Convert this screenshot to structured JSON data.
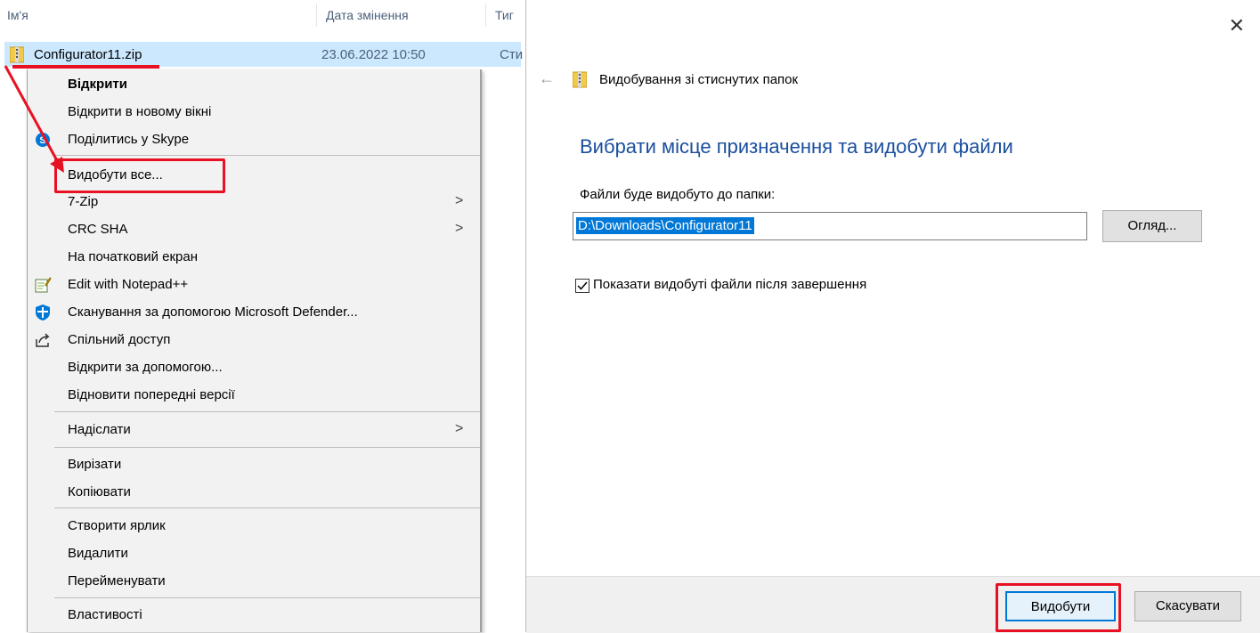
{
  "explorer": {
    "columns": {
      "name": "Ім'я",
      "date": "Дата змінення",
      "type": "Тиг"
    },
    "file": {
      "name": "Configurator11.zip",
      "date": "23.06.2022 10:50",
      "type": "Сти"
    }
  },
  "context_menu": {
    "items": [
      {
        "label": "Відкрити"
      },
      {
        "label": "Відкрити в новому вікні"
      },
      {
        "label": "Поділитись у Skype"
      },
      {
        "label": "Видобути все..."
      },
      {
        "label": "7-Zip"
      },
      {
        "label": "CRC SHA"
      },
      {
        "label": "На початковий екран"
      },
      {
        "label": "Edit with Notepad++"
      },
      {
        "label": "Сканування за допомогою Microsoft Defender..."
      },
      {
        "label": "Спільний доступ"
      },
      {
        "label": "Відкрити за допомогою..."
      },
      {
        "label": "Відновити попередні версії"
      },
      {
        "label": "Надіслати"
      },
      {
        "label": "Вирізати"
      },
      {
        "label": "Копіювати"
      },
      {
        "label": "Створити ярлик"
      },
      {
        "label": "Видалити"
      },
      {
        "label": "Перейменувати"
      },
      {
        "label": "Властивості"
      }
    ]
  },
  "dialog": {
    "title": "Видобування зі стиснутих папок",
    "heading": "Вибрати місце призначення та видобути файли",
    "dest_label": "Файли буде видобуто до папки:",
    "path_value": "D:\\Downloads\\Configurator11",
    "browse_label": "Огляд...",
    "checkbox_label": "Показати видобуті файли після завершення",
    "checkbox_checked": true,
    "extract_label": "Видобути",
    "cancel_label": "Скасувати"
  },
  "colors": {
    "accent": "#0078d7",
    "highlight": "#e81123",
    "heading": "#1a4e9e"
  }
}
